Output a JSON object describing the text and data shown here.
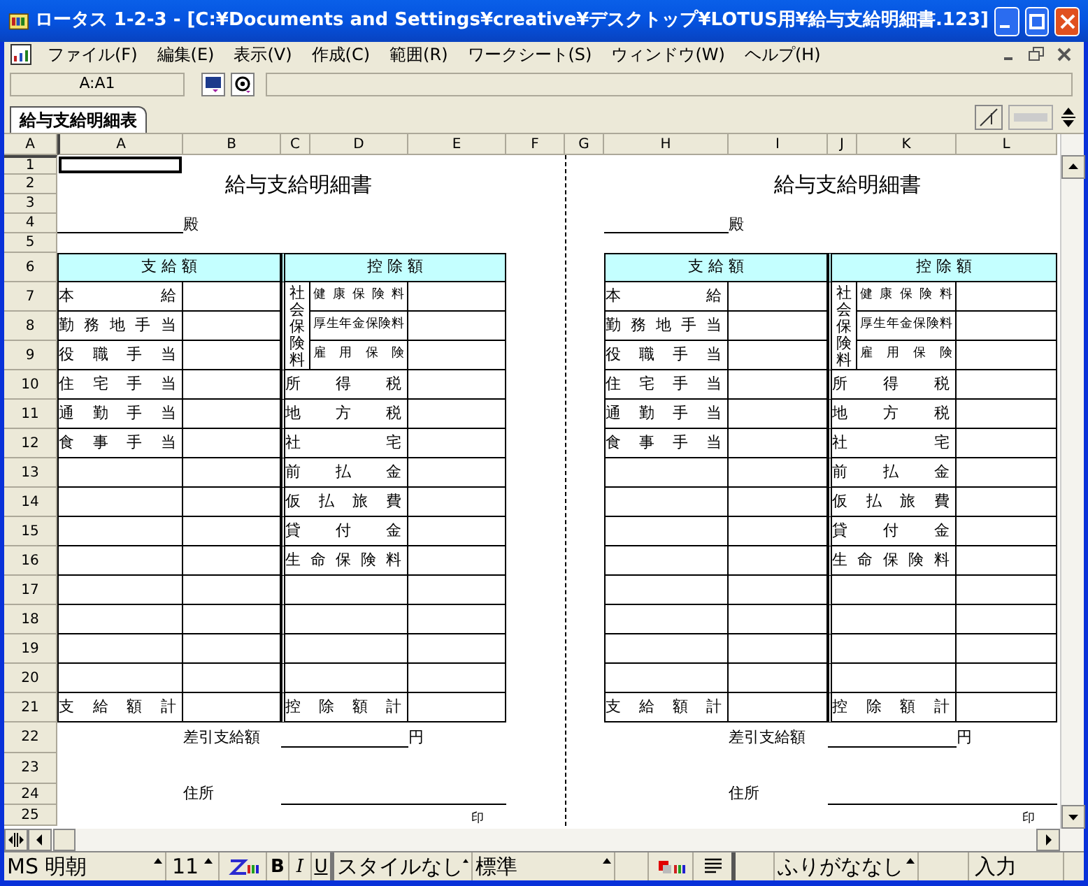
{
  "window": {
    "title": "ロータス 1-2-3 - [C:¥Documents and Settings¥creative¥デスクトップ¥LOTUS用¥給与支給明細書.123]"
  },
  "menu": [
    "ファイル(F)",
    "編集(E)",
    "表示(V)",
    "作成(C)",
    "範囲(R)",
    "ワークシート(S)",
    "ウィンドウ(W)",
    "ヘルプ(H)"
  ],
  "formula_bar": {
    "cell": "A:A1"
  },
  "sheet_tabs": [
    {
      "label": "給与支給明細表",
      "selected": true
    }
  ],
  "sheet_letter": "A",
  "columns": [
    {
      "label": "A",
      "selected": true
    },
    {
      "label": "B",
      "selected": false
    },
    {
      "label": "C",
      "selected": false
    },
    {
      "label": "D",
      "selected": false
    },
    {
      "label": "E",
      "selected": false
    },
    {
      "label": "F",
      "selected": false
    },
    {
      "label": "G",
      "selected": false
    },
    {
      "label": "H",
      "selected": false
    },
    {
      "label": "I",
      "selected": false
    },
    {
      "label": "J",
      "selected": false
    },
    {
      "label": "K",
      "selected": false
    },
    {
      "label": "L",
      "selected": false
    }
  ],
  "rows": [
    {
      "label": "1",
      "selected": true
    },
    {
      "label": "2",
      "selected": false
    },
    {
      "label": "3",
      "selected": false
    },
    {
      "label": "4",
      "selected": false
    },
    {
      "label": "5",
      "selected": false
    },
    {
      "label": "6",
      "selected": false
    },
    {
      "label": "7",
      "selected": false
    },
    {
      "label": "8",
      "selected": false
    },
    {
      "label": "9",
      "selected": false
    },
    {
      "label": "10",
      "selected": false
    },
    {
      "label": "11",
      "selected": false
    },
    {
      "label": "12",
      "selected": false
    },
    {
      "label": "13",
      "selected": false
    },
    {
      "label": "14",
      "selected": false
    },
    {
      "label": "15",
      "selected": false
    },
    {
      "label": "16",
      "selected": false
    },
    {
      "label": "17",
      "selected": false
    },
    {
      "label": "18",
      "selected": false
    },
    {
      "label": "19",
      "selected": false
    },
    {
      "label": "20",
      "selected": false
    },
    {
      "label": "21",
      "selected": false
    },
    {
      "label": "22",
      "selected": false
    },
    {
      "label": "23",
      "selected": false
    },
    {
      "label": "24",
      "selected": false
    },
    {
      "label": "25",
      "selected": false
    }
  ],
  "forms": [
    {
      "title": "給与支給明細書",
      "addressee_suffix": "殿",
      "payments_header": "支 給 額",
      "deductions_header": "控 除 額",
      "payments": [
        "本 給",
        "勤 務 地 手 当",
        "役 職 手 当",
        "住 宅 手 当",
        "通 勤 手 当",
        "食 事 手 当"
      ],
      "payments_total": "支 給 額 計",
      "social_insurance_label": "社会保険料",
      "insurance_items": [
        "健 康 保 険 料",
        "厚生年金保険料",
        "雇 用 保 険"
      ],
      "deductions": [
        "所 得 税",
        "地 方 税",
        "社 宅",
        "前 払 金",
        "仮 払 旅 費",
        "貸 付 金",
        "生 命 保 険 料"
      ],
      "deductions_total": "控 除 額 計",
      "net_pay_label": "差引支給額",
      "yen": "円",
      "address_label": "住所",
      "seal": "印"
    },
    {
      "title": "給与支給明細書",
      "addressee_suffix": "殿",
      "payments_header": "支 給 額",
      "deductions_header": "控 除 額",
      "payments": [
        "本 給",
        "勤 務 地 手 当",
        "役 職 手 当",
        "住 宅 手 当",
        "通 勤 手 当",
        "食 事 手 当"
      ],
      "payments_total": "支 給 額 計",
      "social_insurance_label": "社会保険料",
      "insurance_items": [
        "健 康 保 険 料",
        "厚生年金保険料",
        "雇 用 保 険"
      ],
      "deductions": [
        "所 得 税",
        "地 方 税",
        "社 宅",
        "前 払 金",
        "仮 払 旅 費",
        "貸 付 金",
        "生 命 保 険 料"
      ],
      "deductions_total": "控 除 額 計",
      "net_pay_label": "差引支給額",
      "yen": "円",
      "address_label": "住所",
      "seal": "印"
    }
  ],
  "status_bar": {
    "font": "MS 明朝",
    "size": "11",
    "bold": "B",
    "italic": "I",
    "underline": "U",
    "style": "スタイルなし",
    "format": "標準",
    "furigana": "ふりがななし",
    "mode": "入力"
  }
}
